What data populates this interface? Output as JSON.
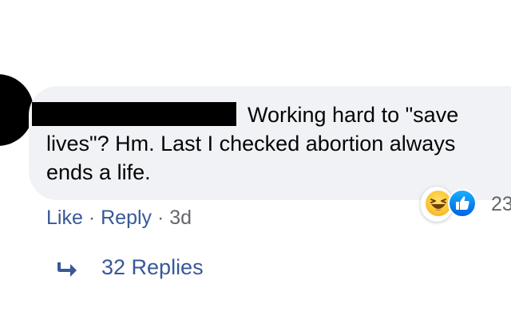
{
  "comment": {
    "author_redacted": true,
    "text": "Working hard to \"save lives\"? Hm. Last I checked abortion always ends a life.",
    "reactions": {
      "icons": [
        "haha-icon",
        "like-icon"
      ],
      "count": "23"
    }
  },
  "actions": {
    "like_label": "Like",
    "separator": "·",
    "reply_label": "Reply",
    "timestamp": "3d"
  },
  "replies": {
    "label": "32 Replies"
  },
  "colors": {
    "bubble": "#f0f2f5",
    "link": "#385898",
    "muted": "#65676b",
    "text": "#050505"
  }
}
